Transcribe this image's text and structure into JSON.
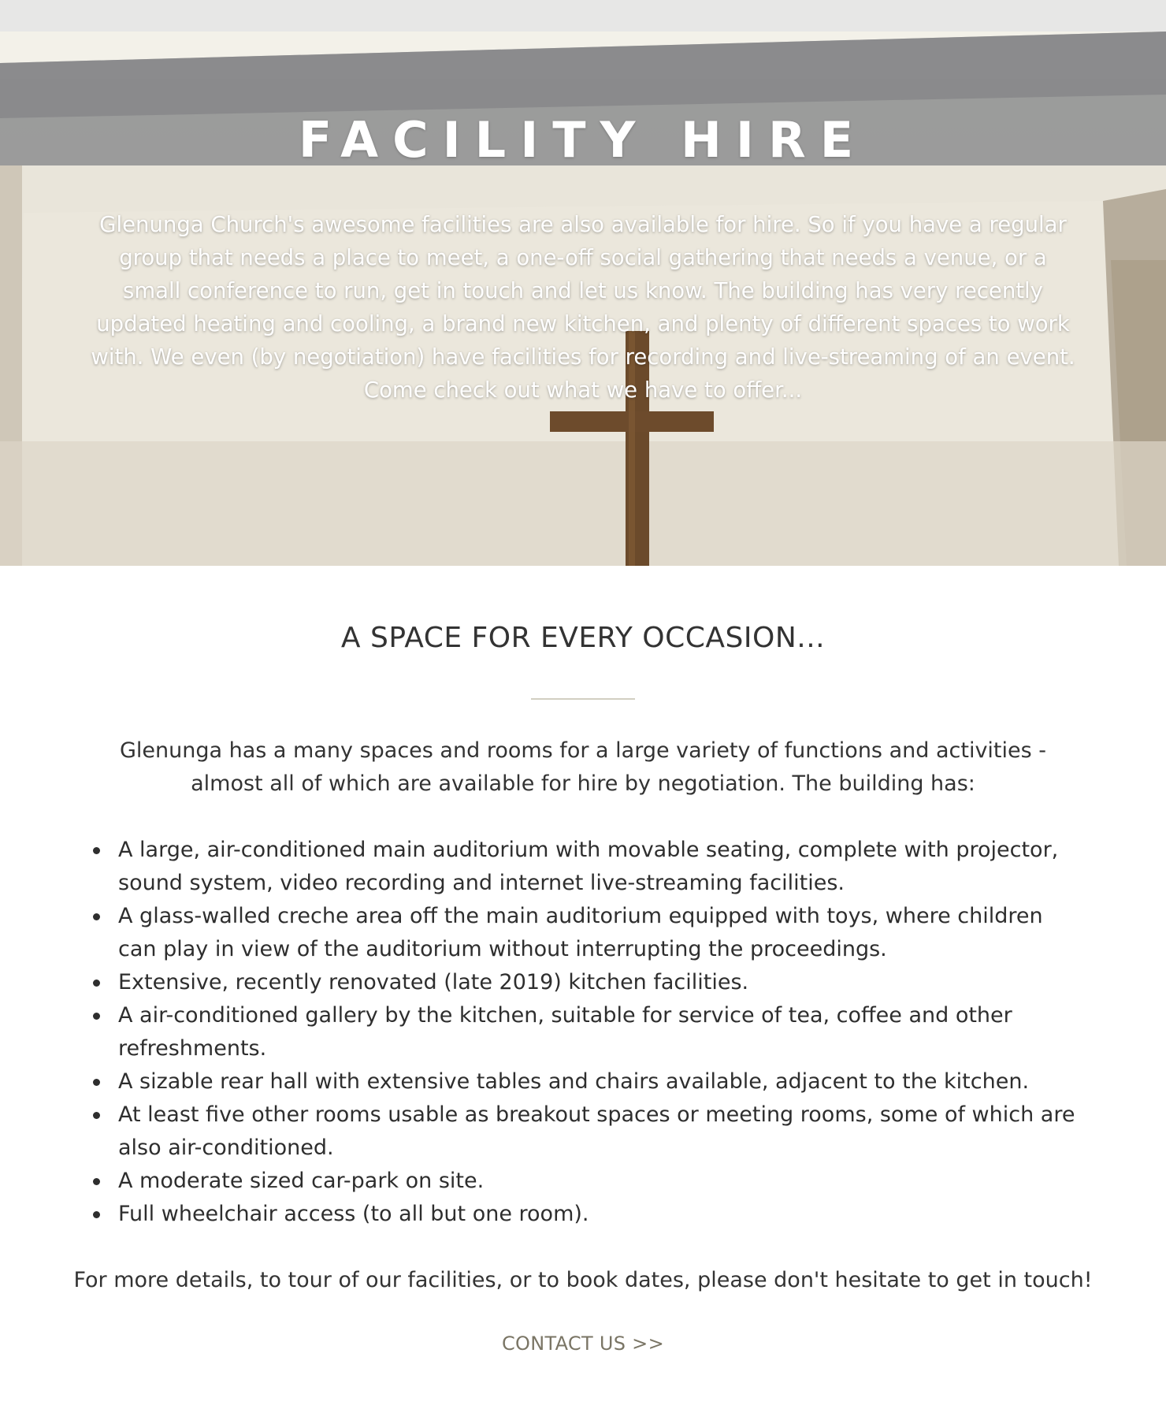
{
  "hero": {
    "title": "FACILITY HIRE",
    "description": "Glenunga Church's awesome facilities are also available for hire. So if you have a regular group that needs a place to meet, a one-off social gathering that needs a venue, or a small conference to run, get in touch and let us know. The building has very recently updated heating and cooling, a brand new kitchen, and plenty of different spaces to work with. We even (by negotiation) have facilities for recording and live-streaming of an event. Come check out what we have to offer..."
  },
  "section": {
    "heading": "A SPACE FOR EVERY OCCASION...",
    "intro": "Glenunga has a many spaces and rooms for a large variety of functions and activities - almost all of which are available for hire by negotiation. The building has:",
    "features": [
      "A large, air-conditioned main auditorium with movable seating, complete with projector, sound system, video recording and internet live-streaming facilities.",
      "A glass-walled creche area off the main auditorium equipped with toys, where children can play in view of the auditorium without interrupting the proceedings.",
      "Extensive, recently renovated (late 2019) kitchen facilities.",
      "A air-conditioned gallery by the kitchen, suitable for service of tea, coffee and other refreshments.",
      "A sizable rear hall with extensive tables and chairs available, adjacent to the kitchen.",
      "At least five other rooms usable as breakout spaces or meeting rooms, some of which are also air-conditioned.",
      "A moderate sized car-park on site.",
      "Full wheelchair access (to all but one room)."
    ],
    "outro": "For more details, to tour of our facilities, or to book dates, please don't hesitate to get in touch!",
    "contact_label": "CONTACT US >>"
  },
  "colors": {
    "heading_text": "#333333",
    "body_text": "#2b2b2b",
    "link": "#7a7565",
    "divider": "#d2cfc2"
  }
}
